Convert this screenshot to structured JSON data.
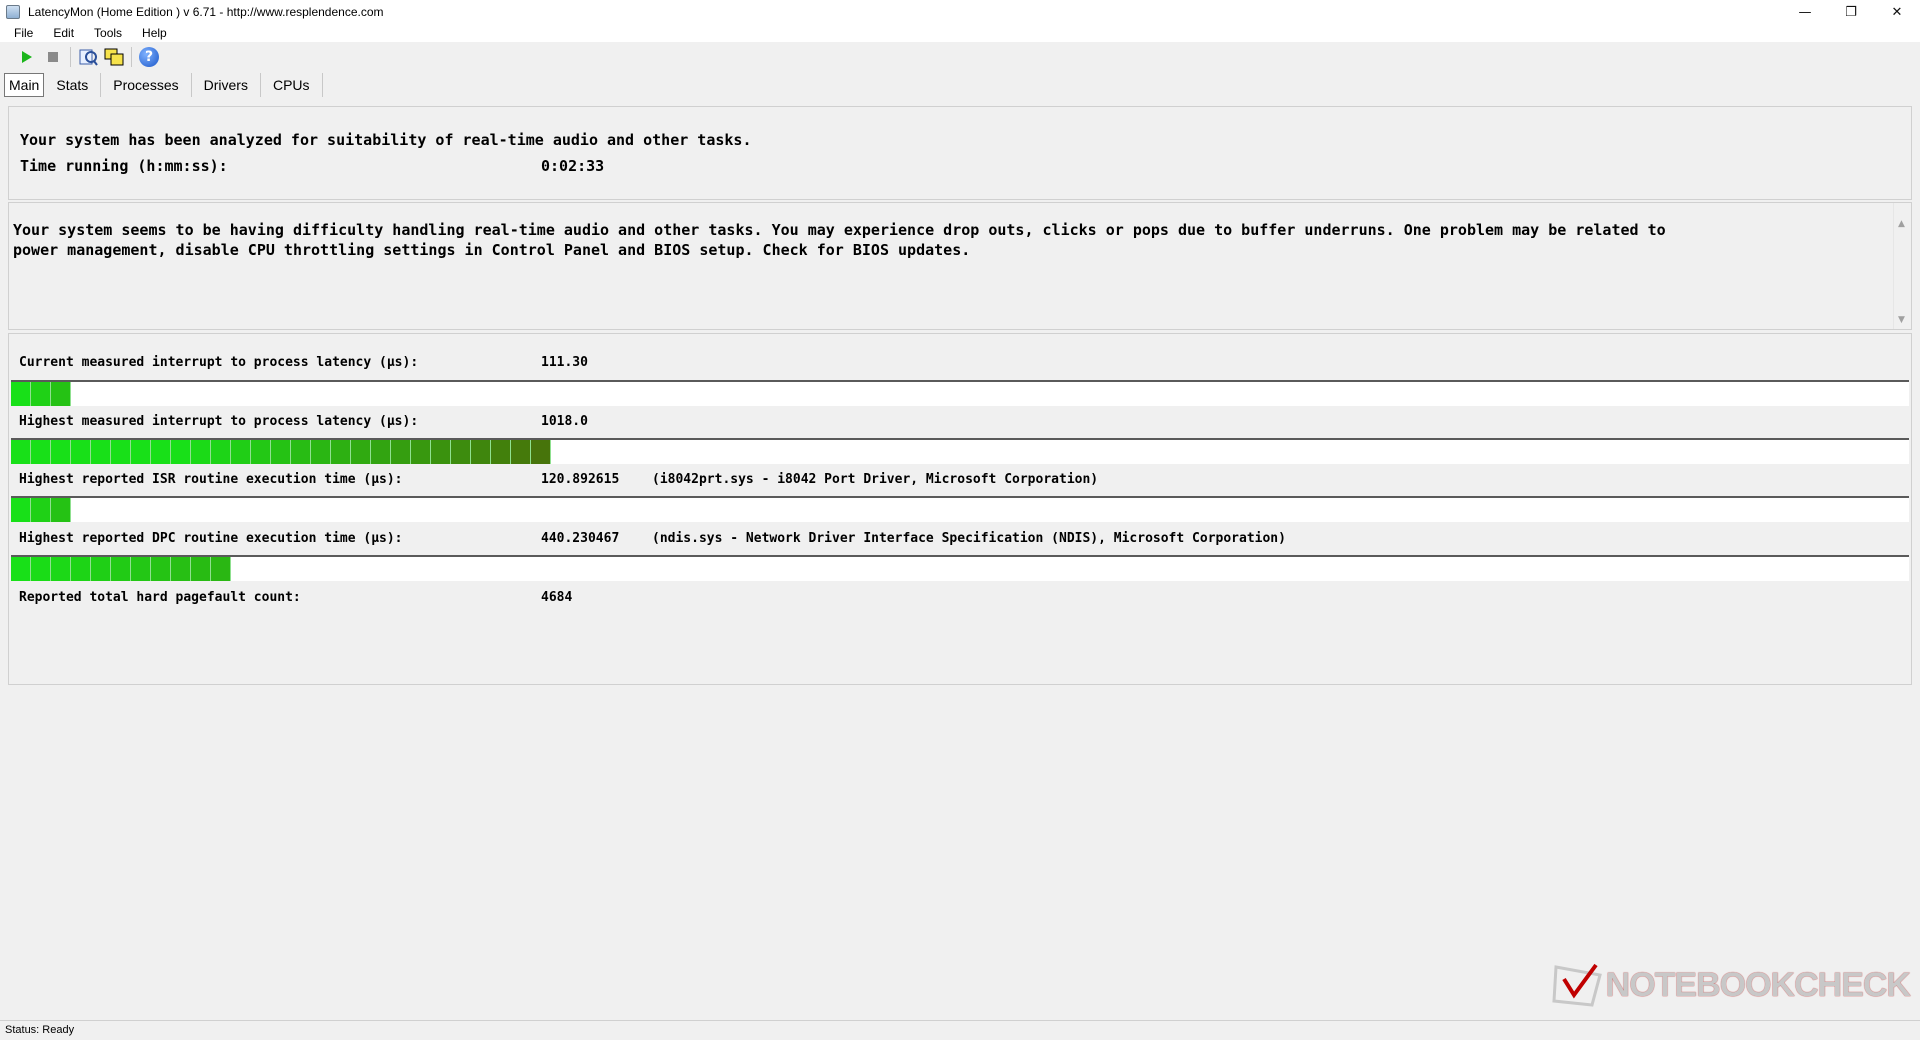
{
  "window": {
    "title": "LatencyMon  (Home Edition )  v 6.71 - http://www.resplendence.com",
    "minimize": "—",
    "maximize": "❐",
    "close": "✕"
  },
  "menu": {
    "items": [
      "File",
      "Edit",
      "Tools",
      "Help"
    ]
  },
  "toolbar": {
    "buttons": [
      "play-icon",
      "stop-icon",
      "report-icon",
      "windows-icon",
      "help-icon"
    ]
  },
  "tabs": [
    {
      "label": "Main",
      "active": true
    },
    {
      "label": "Stats"
    },
    {
      "label": "Processes"
    },
    {
      "label": "Drivers"
    },
    {
      "label": "CPUs"
    }
  ],
  "summary": {
    "line1": "Your system has been analyzed for suitability of real-time audio and other tasks.",
    "time_label": "Time running (h:mm:ss):",
    "time_value": "0:02:33"
  },
  "message": "Your system seems to be having difficulty handling real-time audio and other tasks. You may experience drop outs, clicks or pops due to buffer underruns. One problem may be related to\npower management, disable CPU throttling settings in Control Panel and BIOS setup. Check for BIOS updates.",
  "metrics": [
    {
      "label": "Current measured interrupt to process latency (µs):",
      "value": "111.30",
      "note": "",
      "bar_segments": 3
    },
    {
      "label": "Highest measured interrupt to process latency (µs):",
      "value": "1018.0",
      "note": "",
      "bar_segments": 27
    },
    {
      "label": "Highest reported ISR routine execution time (µs):",
      "value": "120.892615",
      "note": "(i8042prt.sys - i8042 Port Driver, Microsoft Corporation)",
      "bar_segments": 3
    },
    {
      "label": "Highest reported DPC routine execution time (µs):",
      "value": "440.230467",
      "note": "(ndis.sys - Network Driver Interface Specification (NDIS), Microsoft Corporation)",
      "bar_segments": 11
    },
    {
      "label": "Reported total hard pagefault count:",
      "value": "4684",
      "note": ""
    }
  ],
  "status": "Status: Ready",
  "watermark": "NOTEBOOKCHECK",
  "colors": {
    "bar_green": "#18e018",
    "bar_dark": "#4a6e0a",
    "accent_red": "#c00000"
  }
}
